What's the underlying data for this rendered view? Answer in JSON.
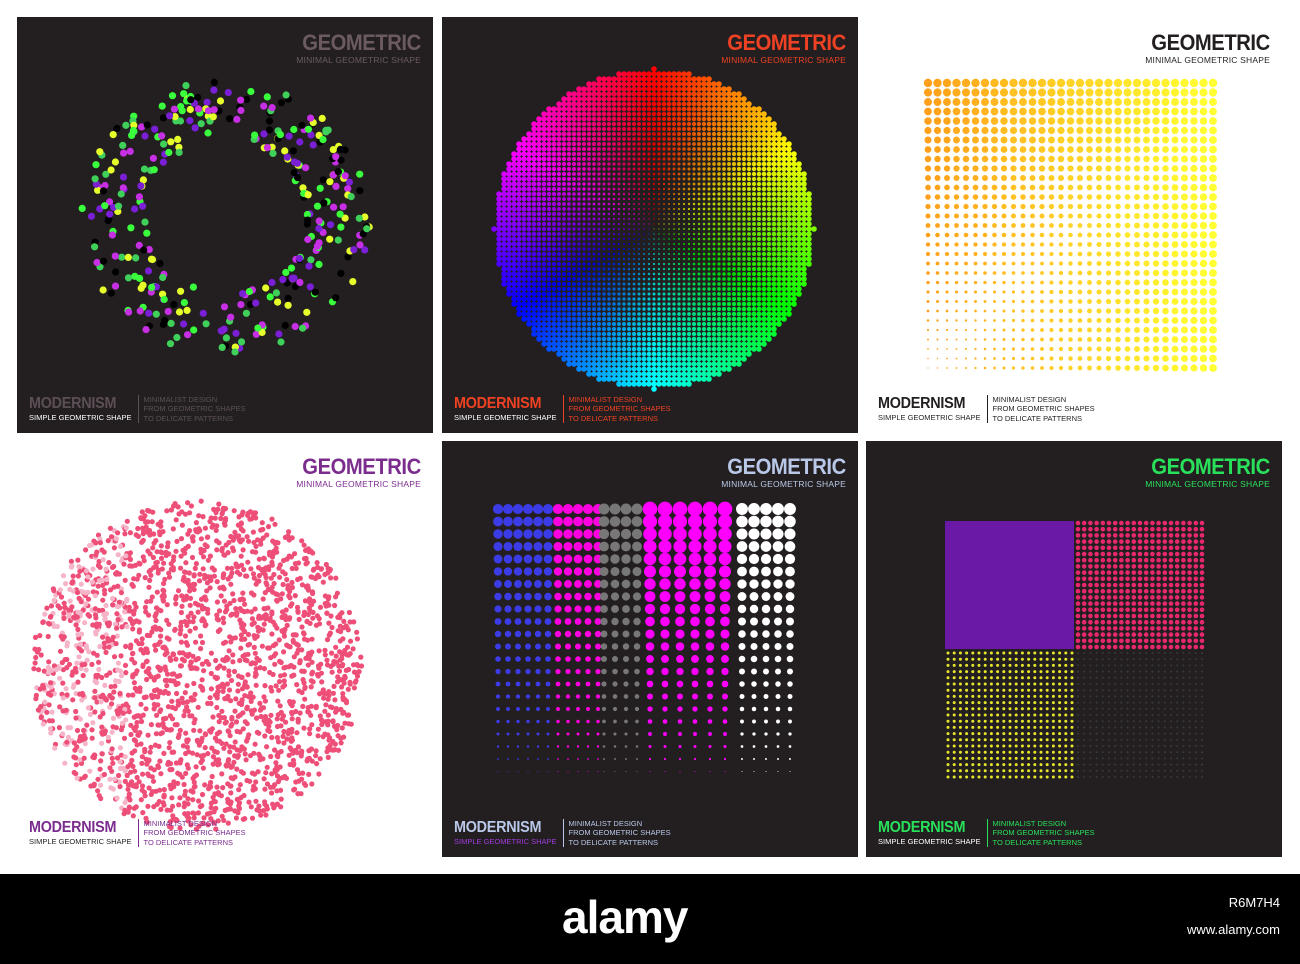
{
  "colors": {
    "dark_bg": "#231f20",
    "light_bg": "#ffffff"
  },
  "panels": [
    {
      "id": "p1",
      "theme": "dark",
      "title": "GEOMETRIC",
      "subtitle": "MINIMAL GEOMETRIC SHAPE",
      "footer_title": "MODERNISM",
      "footer_subtitle": "SIMPLE GEOMETRIC SHAPE",
      "footer_lines": [
        "MINIMALIST DESIGN",
        "FROM GEOMETRIC SHAPES",
        "TO DELICATE PATTERNS"
      ],
      "title_color": "#6b5b60",
      "footer_title_color": "#5b4f55",
      "footer_text_color": "#5b5055",
      "art": "scattered-dot-ring"
    },
    {
      "id": "p2",
      "theme": "dark",
      "title": "GEOMETRIC",
      "subtitle": "MINIMAL GEOMETRIC SHAPE",
      "footer_title": "MODERNISM",
      "footer_subtitle": "SIMPLE GEOMETRIC SHAPE",
      "footer_lines": [
        "MINIMALIST DESIGN",
        "FROM GEOMETRIC SHAPES",
        "TO DELICATE PATTERNS"
      ],
      "title_color": "#ef4123",
      "footer_title_color": "#ef4123",
      "footer_text_color": "#ef4123",
      "art": "rainbow-halftone-circle"
    },
    {
      "id": "p3",
      "theme": "light",
      "title": "GEOMETRIC",
      "subtitle": "MINIMAL GEOMETRIC SHAPE",
      "footer_title": "MODERNISM",
      "footer_subtitle": "SIMPLE GEOMETRIC SHAPE",
      "footer_lines": [
        "MINIMALIST DESIGN",
        "FROM GEOMETRIC SHAPES",
        "TO DELICATE PATTERNS"
      ],
      "title_color": "#231f20",
      "footer_title_color": "#231f20",
      "footer_text_color": "#231f20",
      "art": "yellow-halftone-square"
    },
    {
      "id": "p4",
      "theme": "light",
      "title": "GEOMETRIC",
      "subtitle": "MINIMAL GEOMETRIC SHAPE",
      "footer_title": "MODERNISM",
      "footer_subtitle": "SIMPLE GEOMETRIC SHAPE",
      "footer_lines": [
        "MINIMALIST DESIGN",
        "FROM GEOMETRIC SHAPES",
        "TO DELICATE PATTERNS"
      ],
      "title_color": "#7b2d8e",
      "footer_title_color": "#7b2d8e",
      "footer_text_color": "#7b2d8e",
      "art": "pink-dot-circle"
    },
    {
      "id": "p5",
      "theme": "dark",
      "title": "GEOMETRIC",
      "subtitle": "MINIMAL GEOMETRIC SHAPE",
      "footer_title": "MODERNISM",
      "footer_subtitle": "SIMPLE GEOMETRIC SHAPE",
      "footer_lines": [
        "MINIMALIST DESIGN",
        "FROM GEOMETRIC SHAPES",
        "TO DELICATE PATTERNS"
      ],
      "title_color": "#b9c8e8",
      "footer_title_color": "#b9c8e8",
      "footer_subtitle_color": "#a23be0",
      "footer_text_color": "#b9c8e8",
      "art": "multicolor-halftone-columns"
    },
    {
      "id": "p6",
      "theme": "dark",
      "title": "GEOMETRIC",
      "subtitle": "MINIMAL GEOMETRIC SHAPE",
      "footer_title": "MODERNISM",
      "footer_subtitle": "SIMPLE GEOMETRIC SHAPE",
      "footer_lines": [
        "MINIMALIST DESIGN",
        "FROM GEOMETRIC SHAPES",
        "TO DELICATE PATTERNS"
      ],
      "title_color": "#29e05a",
      "footer_title_color": "#29e05a",
      "footer_text_color": "#29e05a",
      "art": "four-quadrant-halftone"
    }
  ],
  "watermark": {
    "logo": "alamy",
    "image_id": "R6M7H4",
    "site": "www.alamy.com"
  }
}
